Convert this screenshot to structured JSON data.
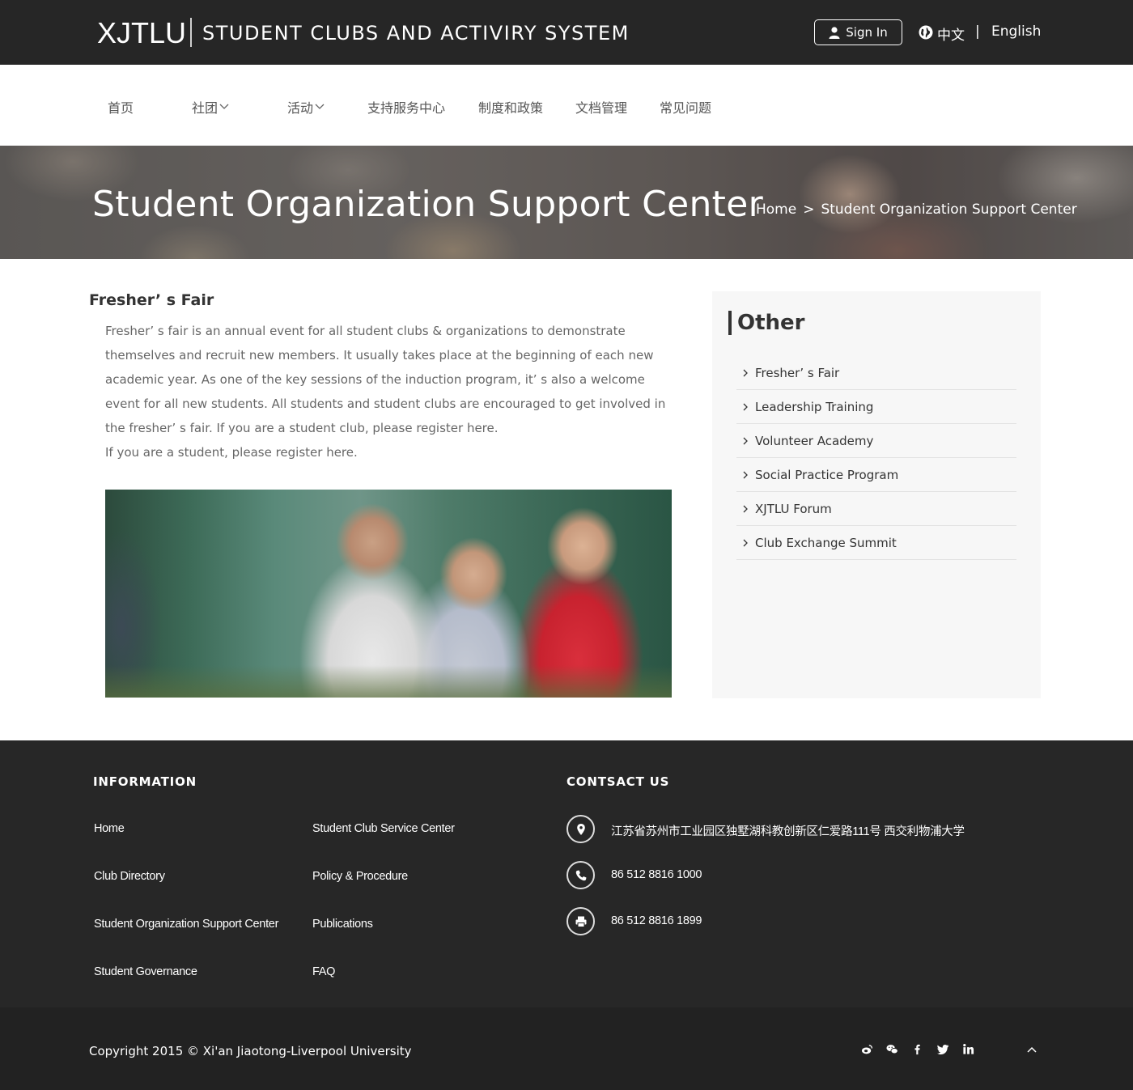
{
  "header": {
    "logo": "XJTLU",
    "system_title": "STUDENT CLUBS AND ACTIVIRY SYSTEM",
    "sign_in": "Sign In",
    "lang_zh": "中文",
    "lang_sep": "|",
    "lang_en": "English"
  },
  "nav": {
    "items": [
      {
        "label": "首页"
      },
      {
        "label": "社团"
      },
      {
        "label": "活动"
      },
      {
        "label": "支持服务中心"
      },
      {
        "label": "制度和政策"
      },
      {
        "label": "文档管理"
      },
      {
        "label": "常见问题"
      }
    ]
  },
  "banner": {
    "title": "Student Organization Support Center",
    "breadcrumb": [
      "Home",
      ">",
      "Student Organization Support Center"
    ]
  },
  "article": {
    "title": "Fresher’ s Fair",
    "paragraph1": "Fresher’ s fair is an annual event for all student clubs & organizations to demonstrate themselves and recruit new members. It usually takes place at the beginning of each new academic year. As one of the key sessions of the induction program, it’ s also a welcome event for all new students. All students and student clubs are encouraged to get involved in the fresher’ s fair. If you are a student club, please register here.",
    "paragraph2": "If you are a student, please register here."
  },
  "sidebar": {
    "heading": "Other",
    "items": [
      {
        "label": "Fresher’ s Fair"
      },
      {
        "label": "Leadership Training"
      },
      {
        "label": "Volunteer Academy"
      },
      {
        "label": "Social Practice Program"
      },
      {
        "label": "XJTLU Forum"
      },
      {
        "label": "Club Exchange Summit"
      }
    ]
  },
  "footer": {
    "info_heading": "INFORMATION",
    "contact_heading": "CONTSACT US",
    "links": [
      {
        "label": "Home"
      },
      {
        "label": "Student Club Service Center"
      },
      {
        "label": "Club Directory"
      },
      {
        "label": "Policy & Procedure"
      },
      {
        "label": "Student Organization Support Center"
      },
      {
        "label": "Publications"
      },
      {
        "label": "Student Governance"
      },
      {
        "label": "FAQ"
      }
    ],
    "address": "江苏省苏州市工业园区独墅湖科教创新区仁爱路111号  西交利物浦大学",
    "phone": "86 512 8816 1000",
    "fax": "86 512 8816 1899",
    "copyright": "Copyright 2015 © Xi'an Jiaotong-Liverpool University",
    "social_icons": [
      "weibo-icon",
      "wechat-icon",
      "facebook-icon",
      "twitter-icon",
      "linkedin-icon"
    ]
  },
  "colors": {
    "header_bg": "#262626",
    "footer_bg": "#272727",
    "bottom_bg": "#222222",
    "sidebar_bg": "#f7f7f7"
  }
}
